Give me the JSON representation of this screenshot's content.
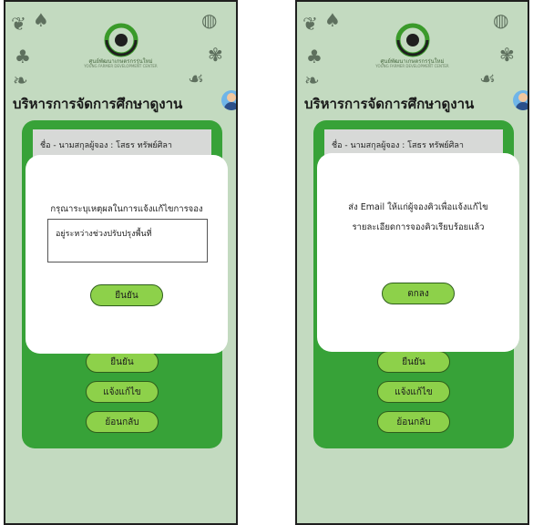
{
  "brand": {
    "name": "ศูนย์พัฒนาเกษตรกรรุ่นใหม่",
    "subtitle": "YOUNG FARMER DEVELOPMENT CENTER"
  },
  "page_title": "บริหารการจัดการศึกษาดูงาน",
  "left_screen": {
    "info_text": "ชื่อ - นามสกุลผู้จอง : โสธร ทรัพย์ศิลา",
    "modal": {
      "prompt": "กรุณาระบุเหตุผลในการแจ้งแก้ไขการจอง",
      "reason_value": "อยู่ระหว่างช่วงปรับปรุงพื้นที่",
      "confirm_label": "ยืนยัน"
    },
    "buttons": {
      "confirm": "ยืนยัน",
      "report_edit": "แจ้งแก้ไข",
      "back": "ย้อนกลับ"
    }
  },
  "right_screen": {
    "info_text": "ชื่อ - นามสกุลผู้จอง : โสธร ทรัพย์ศิลา",
    "modal": {
      "message_line1": "ส่ง Email ให้แก่ผู้จองคิวเพื่อแจ้งแก้ไข",
      "message_line2": "รายละเอียดการจองคิวเรียบร้อยแล้ว",
      "ok_label": "ตกลง"
    },
    "buttons": {
      "confirm": "ยืนยัน",
      "report_edit": "แจ้งแก้ไข",
      "back": "ย้อนกลับ"
    }
  },
  "colors": {
    "background": "#c3dac0",
    "panel_green": "#37a238",
    "button_green": "#8dd14a",
    "logo_green": "#3a9a2a"
  },
  "icons": [
    "pepper-icon",
    "carrot-icon",
    "broccoli-icon",
    "tomato-icon",
    "onion-icon",
    "leaf-icon",
    "user-avatar-icon"
  ]
}
